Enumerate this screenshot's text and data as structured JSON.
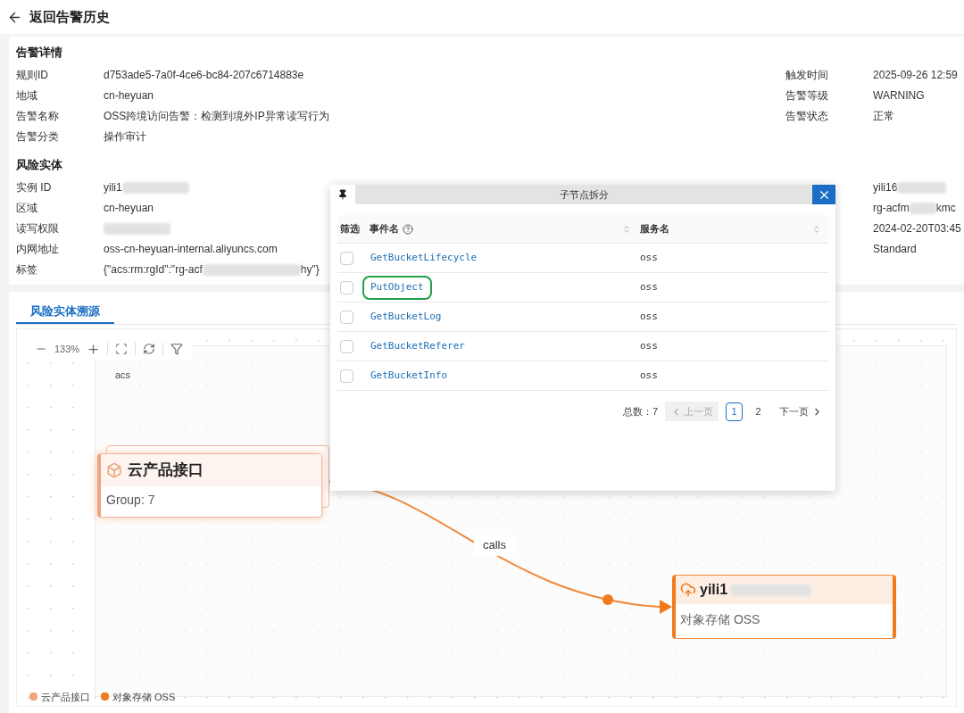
{
  "header": {
    "back_label": "返回告警历史"
  },
  "alert_details": {
    "title": "告警详情",
    "fields_left": [
      {
        "label": "规则ID",
        "value": "d753ade5-7a0f-4ce6-bc84-207c6714883e"
      },
      {
        "label": "地域",
        "value": "cn-heyuan"
      },
      {
        "label": "告警名称",
        "value": "OSS跨境访问告警：检测到境外IP异常读写行为"
      },
      {
        "label": "告警分类",
        "value": "操作审计"
      }
    ],
    "fields_right": [
      {
        "label": "触发时间",
        "value": "2025-09-26 12:59"
      },
      {
        "label": "告警等级",
        "value": "WARNING"
      },
      {
        "label": "告警状态",
        "value": "正常"
      }
    ]
  },
  "risk_entity": {
    "title": "风险实体",
    "fields_left": [
      {
        "label": "实例 ID",
        "value": "yili1",
        "redacted": true
      },
      {
        "label": "区域",
        "value": "cn-heyuan"
      },
      {
        "label": "读写权限",
        "redacted": true
      },
      {
        "label": "内网地址",
        "value": "oss-cn-heyuan-internal.aliyuncs.com"
      },
      {
        "label": "标签",
        "value": "{\"acs:rm:rgId\":\"rg-acf",
        "redacted": true,
        "value_after": "hy\"}"
      }
    ],
    "fields_right": [
      {
        "value": "yili16",
        "redacted": true
      },
      {
        "value": "rg-acfm",
        "redacted": true,
        "value_after": "kmc"
      },
      {
        "value": "2024-02-20T03:45"
      },
      {
        "value": "Standard"
      }
    ]
  },
  "tabs": [
    {
      "label": "风险实体溯源",
      "selected": true
    }
  ],
  "graph": {
    "zoom": "133%",
    "group_label": "acs",
    "edge_label": "calls",
    "source_node": {
      "title": "云产品接口",
      "subtitle": "Group: 7"
    },
    "target_node": {
      "title": "yili1",
      "redacted": true,
      "subtitle": "对象存储 OSS"
    },
    "legend": [
      {
        "label": "云产品接口",
        "color": "#f4a47c"
      },
      {
        "label": "对象存储 OSS",
        "color": "#f07a1c"
      }
    ]
  },
  "dialog": {
    "title": "子节点拆分",
    "columns": [
      "筛选",
      "事件名",
      "服务名"
    ],
    "rows": [
      {
        "event": "GetBucketLifecycle",
        "service": "oss",
        "checked": false,
        "highlighted": false
      },
      {
        "event": "PutObject",
        "service": "oss",
        "checked": false,
        "highlighted": true
      },
      {
        "event": "GetBucketLog",
        "service": "oss",
        "checked": false,
        "highlighted": false
      },
      {
        "event": "GetBucketReferer",
        "service": "oss",
        "checked": false,
        "highlighted": false
      },
      {
        "event": "GetBucketInfo",
        "service": "oss",
        "checked": false,
        "highlighted": false
      }
    ],
    "pagination": {
      "total": "总数：7",
      "prev": "上一页",
      "prev_disabled": true,
      "next": "下一页",
      "pages": [
        {
          "label": "1",
          "selected": true
        },
        {
          "label": "2",
          "selected": false
        }
      ]
    }
  }
}
